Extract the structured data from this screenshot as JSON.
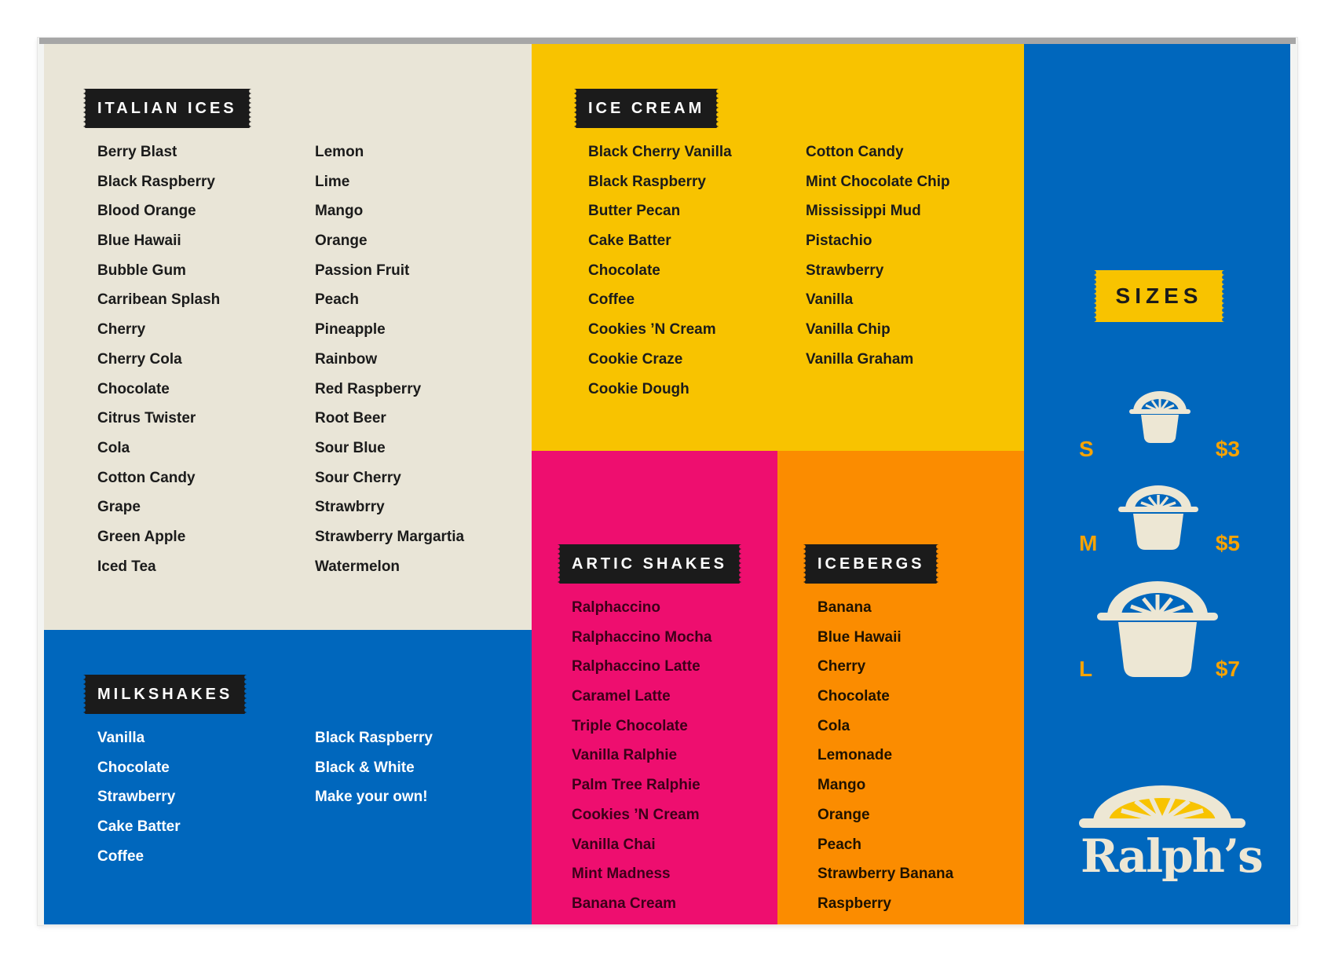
{
  "colors": {
    "cream": "#e9e5d7",
    "yellow": "#f8c300",
    "blue": "#0067bd",
    "pink": "#ee0e6f",
    "orange": "#fb8c00",
    "tag_black": "#1b1b1b",
    "size_text": "#f8a300"
  },
  "italian_ices": {
    "title": "ITALIAN ICES",
    "col1": [
      "Berry Blast",
      "Black Raspberry",
      "Blood Orange",
      "Blue Hawaii",
      "Bubble Gum",
      "Carribean Splash",
      "Cherry",
      "Cherry Cola",
      "Chocolate",
      "Citrus Twister",
      "Cola",
      "Cotton Candy",
      "Grape",
      "Green Apple",
      "Iced Tea"
    ],
    "col2": [
      "Lemon",
      "Lime",
      "Mango",
      "Orange",
      "Passion Fruit",
      "Peach",
      "Pineapple",
      "Rainbow",
      "Red Raspberry",
      "Root Beer",
      "Sour Blue",
      "Sour Cherry",
      "Strawbrry",
      "Strawberry Margartia",
      "Watermelon"
    ]
  },
  "ice_cream": {
    "title": "ICE CREAM",
    "col1": [
      "Black Cherry Vanilla",
      "Black Raspberry",
      "Butter Pecan",
      "Cake Batter",
      "Chocolate",
      "Coffee",
      "Cookies ’N Cream",
      "Cookie Craze",
      "Cookie Dough"
    ],
    "col2": [
      "Cotton Candy",
      "Mint Chocolate Chip",
      "Mississippi Mud",
      "Pistachio",
      "Strawberry",
      "Vanilla",
      "Vanilla Chip",
      "Vanilla Graham"
    ]
  },
  "milkshakes": {
    "title": "MILKSHAKES",
    "col1": [
      "Vanilla",
      "Chocolate",
      "Strawberry",
      "Cake Batter",
      "Coffee"
    ],
    "col2": [
      "Black Raspberry",
      "Black & White",
      "Make your own!"
    ]
  },
  "artic_shakes": {
    "title": "ARTIC SHAKES",
    "items": [
      "Ralphaccino",
      "Ralphaccino Mocha",
      "Ralphaccino Latte",
      "Caramel Latte",
      "Triple Chocolate",
      "Vanilla Ralphie",
      "Palm Tree Ralphie",
      "Cookies ’N Cream",
      "Vanilla Chai",
      "Mint Madness",
      "Banana Cream"
    ]
  },
  "icebergs": {
    "title": "ICEBERGS",
    "items": [
      "Banana",
      "Blue Hawaii",
      "Cherry",
      "Chocolate",
      "Cola",
      "Lemonade",
      "Mango",
      "Orange",
      "Peach",
      "Strawberry Banana",
      "Raspberry"
    ]
  },
  "sizes": {
    "title": "SIZES",
    "options": [
      {
        "letter": "S",
        "price": "$3",
        "icon": "small-cup-icon"
      },
      {
        "letter": "M",
        "price": "$5",
        "icon": "medium-cup-icon"
      },
      {
        "letter": "L",
        "price": "$7",
        "icon": "large-cup-icon"
      }
    ]
  },
  "brand": {
    "name": "Ralph’s",
    "icon": "lemon-slice-logo-icon"
  }
}
